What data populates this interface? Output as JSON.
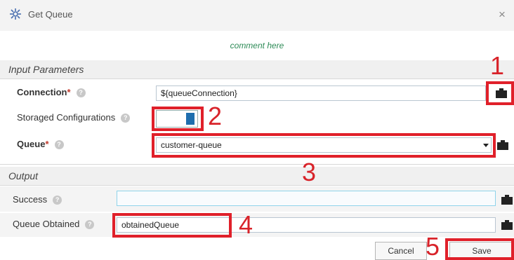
{
  "window": {
    "title": "Get Queue",
    "title_icon": "gear-cluster-icon",
    "close_glyph": "×"
  },
  "comment": "comment here",
  "sections": {
    "input": "Input Parameters",
    "output": "Output"
  },
  "fields": {
    "connection": {
      "label": "Connection",
      "required_mark": "*",
      "value": "${queueConnection}"
    },
    "storaged": {
      "label": "Storaged Configurations",
      "toggle_on": true
    },
    "queue": {
      "label": "Queue",
      "required_mark": "*",
      "value": "customer-queue"
    },
    "success": {
      "label": "Success",
      "value": ""
    },
    "queue_obtained": {
      "label": "Queue Obtained",
      "value": "obtainedQueue"
    }
  },
  "help_glyph": "?",
  "buttons": {
    "cancel": "Cancel",
    "save": "Save"
  },
  "markers": [
    "1",
    "2",
    "3",
    "4",
    "5"
  ],
  "colors": {
    "marker": "#e0202a",
    "accent": "#1f6eae",
    "comment": "#2e8b57",
    "required": "#c0392b"
  }
}
